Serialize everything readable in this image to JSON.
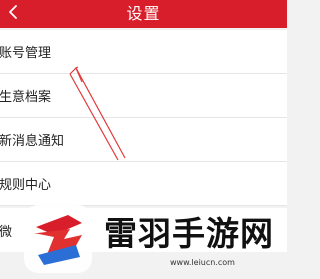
{
  "header": {
    "title": "设置",
    "back_icon": "chevron-left-icon",
    "background_color": "#d81e2a"
  },
  "menu": {
    "items": [
      {
        "label": "账号管理"
      },
      {
        "label": "生意档案"
      },
      {
        "label": "新消息通知"
      },
      {
        "label": "规则中心"
      }
    ],
    "partial_item": {
      "label": "微"
    }
  },
  "annotation": {
    "type": "arrow",
    "color": "#e23a3a",
    "points_to": "账号管理"
  },
  "watermark": {
    "title": "雷羽手游网",
    "url": "www.leiucn.com",
    "logo_colors": [
      "#d81e2a",
      "#2b6fd6"
    ]
  }
}
